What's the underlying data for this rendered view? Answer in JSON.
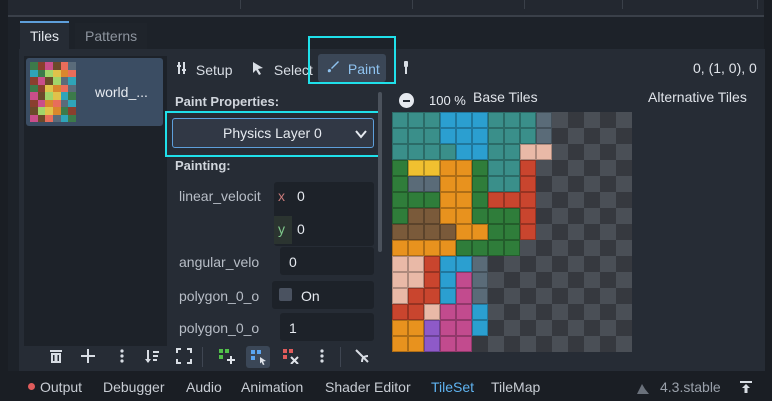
{
  "tabs": {
    "tiles": "Tiles",
    "patterns": "Patterns"
  },
  "tile_source": {
    "label": "world_..."
  },
  "toolbar": {
    "setup": "Setup",
    "select": "Select",
    "paint": "Paint",
    "coords": "0, (1, 0), 0"
  },
  "paint_properties": {
    "heading": "Paint Properties:",
    "layer": "Physics Layer 0",
    "painting_heading": "Painting:"
  },
  "properties": [
    {
      "name": "linear_velocit",
      "x_label": "x",
      "x_value": "0",
      "y_label": "y",
      "y_value": "0"
    },
    {
      "name": "angular_velo",
      "value": "0"
    },
    {
      "name": "polygon_0_o",
      "value": "On"
    },
    {
      "name": "polygon_0_o",
      "value": "1"
    }
  ],
  "atlas": {
    "zoom": "100 %",
    "base_tiles": "Base Tiles",
    "alternative_tiles": "Alternative Tiles"
  },
  "bottom_tabs": [
    "Output",
    "Debugger",
    "Audio",
    "Animation",
    "Shader Editor",
    "TileSet",
    "TileMap"
  ],
  "version": "4.3.stable",
  "colors": {
    "accent": "#5e9fdb",
    "highlight_box": "#1fe0ea",
    "active_tab": "#5e9fdb",
    "error_dot": "#e05c5c"
  }
}
